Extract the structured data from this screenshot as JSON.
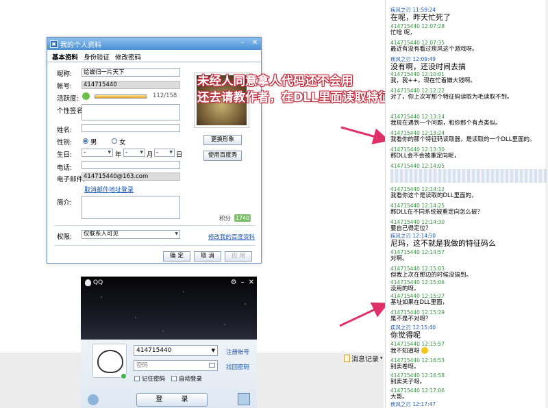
{
  "profile_window": {
    "title": "我的个人资料",
    "tabs": [
      "基本资料",
      "身份验证",
      "修改密码"
    ],
    "fields": {
      "nickname_label": "昵称:",
      "nickname": "给蝶归一片天下",
      "account_label": "帐号:",
      "account": "414715440",
      "activity_label": "活跃度:",
      "activity_value": "112/158",
      "activity_ratio": 0.709,
      "signature_label": "个性签名:",
      "name_label": "姓名:",
      "gender_label": "性别:",
      "gender_male": "男",
      "gender_female": "女",
      "birthday_label": "生日:",
      "birthday_placeholder": "-",
      "year_unit": "年",
      "month_unit": "月",
      "day_unit": "日",
      "phone_label": "电话:",
      "email_label": "电子邮件:",
      "email": "414715440@163.com",
      "cancel_email_login": "取消邮件地址登录",
      "intro_label": "简介:",
      "score_label": "积分",
      "score": "1740",
      "permission_label": "权限:",
      "permission_value": "仅联系人可见",
      "edit_permission_link": "修改我的百度资料"
    },
    "buttons": {
      "change_avatar": "更换形象",
      "use_baidu_show": "使用百度秀",
      "ok": "确 定",
      "cancel": "取 消",
      "apply": "应 用"
    }
  },
  "qq_login": {
    "title": "QQ",
    "account": "414715440",
    "password_placeholder": "密码",
    "register_link": "注册帐号",
    "retrieve_link": "找回密码",
    "remember_password": "记住密码",
    "auto_login": "自动登录",
    "login_button": "登 录"
  },
  "overlay_text": {
    "line1": "未经人同意拿人代码还不会用",
    "line2": "还去请教作者，在DLL里面读取特征码，呵呵"
  },
  "message_record_button": "消息记录",
  "chat": [
    {
      "sender": "疾风之刃",
      "time": "11:59:24",
      "me": true,
      "text": "在呢，昨天忙死了",
      "big": true
    },
    {
      "sender": "414715440",
      "time": "12:07:28",
      "me": false,
      "text": "忙啥 呢，"
    },
    {
      "sender": "414715440",
      "time": "12:07:35",
      "me": false,
      "text": "最近有没有看过疾风这个游戏呀。"
    },
    {
      "sender": "疾风之刃",
      "time": "12:09:49",
      "me": true,
      "text": "没有啊，还没时间去搞",
      "big": true
    },
    {
      "sender": "414715440",
      "time": "12:10:01",
      "me": false,
      "text": "我，我++，现在忙着嫌大钱啊。"
    },
    {
      "sender": "414715440",
      "time": "12:12:22",
      "me": false,
      "text": "对了，你上次写那个特征码读取为毛读取不到。"
    },
    {
      "sender": "414715440",
      "time": "12:13:14",
      "me": false,
      "text": "我现在遇到一个问题，和你那个有点类似。"
    },
    {
      "sender": "414715440",
      "time": "12:13:24",
      "me": false,
      "text": "我看你的那个特征码读取器，是读取的一个DLL里面的。"
    },
    {
      "sender": "414715440",
      "time": "12:13:30",
      "me": false,
      "text": "那DLL会不会被重定向呢，"
    },
    {
      "sender": "414715440",
      "time": "12:14:05",
      "me": false,
      "text": ""
    },
    {
      "sender": "414715440",
      "time": "12:14:12",
      "me": false,
      "text": "我看你这个是读取的DLL里面的，"
    },
    {
      "sender": "414715440",
      "time": "12:14:25",
      "me": false,
      "text": "那DLL在不同系统被重定向怎么破？"
    },
    {
      "sender": "414715440",
      "time": "12:14:30",
      "me": false,
      "text": "要自己得定位？"
    },
    {
      "sender": "疾风之刃",
      "time": "12:14:50",
      "me": true,
      "text": "尼玛，这不就是我做的特征码么",
      "big": true
    },
    {
      "sender": "414715440",
      "time": "12:14:57",
      "me": false,
      "text": "对啊。"
    },
    {
      "sender": "414715440",
      "time": "12:15:03",
      "me": false,
      "text": "但我上次在那边的时候没搞到。"
    },
    {
      "sender": "414715440",
      "time": "12:15:06",
      "me": false,
      "text": "没用的呀。"
    },
    {
      "sender": "414715440",
      "time": "12:15:27",
      "me": false,
      "text": "基址如果在DLL里面，"
    },
    {
      "sender": "414715440",
      "time": "12:15:29",
      "me": false,
      "text": "是不是不对呀？"
    },
    {
      "sender": "疾风之刃",
      "time": "12:15:40",
      "me": true,
      "text": "你觉得呢",
      "big": true
    },
    {
      "sender": "414715440",
      "time": "12:15:57",
      "me": false,
      "text": "我不知道呀",
      "smile": true
    },
    {
      "sender": "414715440",
      "time": "12:16:53",
      "me": false,
      "text": "别卖卷呀。"
    },
    {
      "sender": "414715440",
      "time": "12:16:58",
      "me": false,
      "text": "别卖关子呀。"
    },
    {
      "sender": "414715440",
      "time": "12:17:06",
      "me": false,
      "text": "大哥。"
    },
    {
      "sender": "疾风之刃",
      "time": "12:17:47",
      "me": true,
      "text": ""
    }
  ]
}
